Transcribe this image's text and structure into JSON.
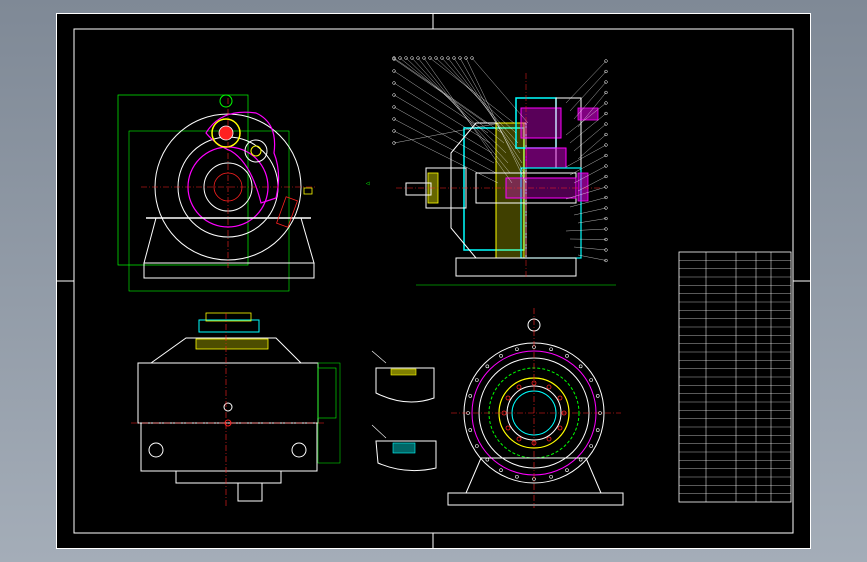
{
  "colors": {
    "background": "#000000",
    "frame": "#ffffff",
    "outline": "#ffffff",
    "dimension": "#00ff00",
    "center_line": "#ff2020",
    "hatch_cyan": "#00ffff",
    "hatch_magenta": "#ff00ff",
    "hatch_yellow": "#ffff00",
    "viewport": "#95a0ac"
  },
  "drawing": {
    "title_block_rows": 30,
    "balloon_count_left": 22,
    "balloon_count_right": 20
  },
  "icons": {
    "section_marker": "arrow-right-icon"
  }
}
